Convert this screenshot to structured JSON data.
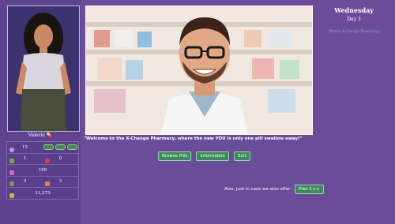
{
  "character": {
    "name": "Valerie",
    "badge_icon": "pill-icon"
  },
  "stats": {
    "row1": {
      "icon": "female-icon",
      "value": "15",
      "pills": 3
    },
    "row2": {
      "icon": "strength-icon",
      "value": "1",
      "icon2": "heart-icon",
      "value2": "0"
    },
    "row3": {
      "icon": "lust-icon",
      "value": "100"
    },
    "row4": {
      "icon": "cash-icon",
      "value": "3",
      "icon2": "bag-icon",
      "value2": "3"
    },
    "row5": {
      "icon": "money-icon",
      "value": "11,275"
    }
  },
  "scene": {
    "dialogue": "\"Welcome to the X-Change Pharmacy, where the new YOU is only one pill swallow away!\""
  },
  "actions": {
    "browse": "Browse Pills",
    "information": "Information",
    "exit": "Exit"
  },
  "offer": {
    "text": "Also, just in case we also offer:",
    "button": "Plan C++"
  },
  "calendar": {
    "day_name": "Wednesday",
    "day_number": "Day 3",
    "subtitle": "(Pharm X-Change Pharmacy)"
  },
  "colors": {
    "background": "#6b4c9a",
    "button_green": "#3f8a5c"
  }
}
